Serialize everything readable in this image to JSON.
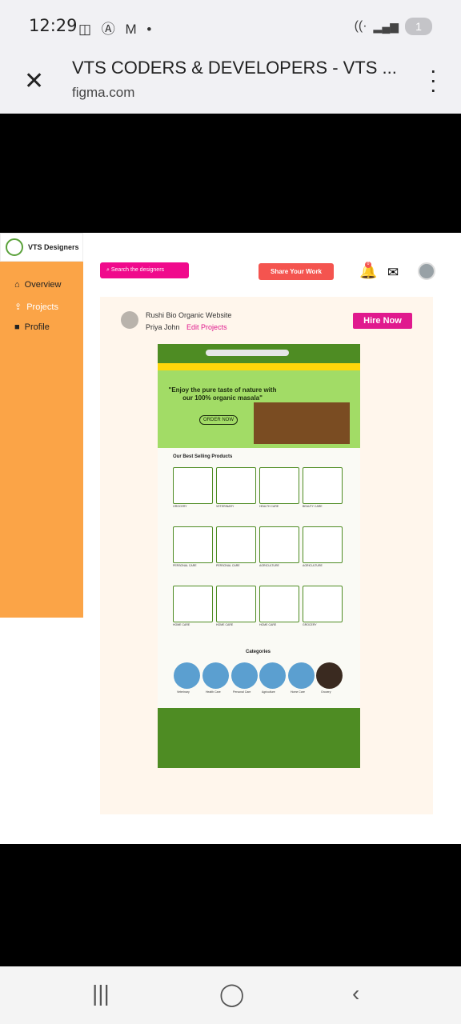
{
  "status_bar": {
    "time": "12:29",
    "icons": "◫ Ⓐ M •",
    "battery": "1"
  },
  "browser": {
    "title": "VTS CODERS & DEVELOPERS - VTS ...",
    "url": "figma.com"
  },
  "sidebar": {
    "logo_text": "VTS Designers",
    "items": [
      {
        "label": "Overview",
        "icon": "home-icon"
      },
      {
        "label": "Projects",
        "icon": "upload-icon"
      },
      {
        "label": "Profile",
        "icon": "folder-icon"
      }
    ]
  },
  "header": {
    "search_label": "Search the designers",
    "share_label": "Share Your Work",
    "notification_count": "0"
  },
  "project": {
    "title": "Rushi Bio Organic Website",
    "author": "Priya John",
    "edit_label": "Edit Projects",
    "hire_label": "Hire Now"
  },
  "design": {
    "hero_text": "\"Enjoy the pure taste of nature with our 100% organic masala\"",
    "order_label": "ORDER NOW",
    "best_selling": "Our Best Selling Products",
    "categories_title": "Categories",
    "products": [
      "GROCERY",
      "VETERINARY",
      "HEALTH CARE",
      "BEAUTY CARE",
      "PERSONAL CARE",
      "PERSONAL CARE",
      "AGRICULTURE",
      "AGRICULTURE",
      "HOME CARE",
      "HOME CARE",
      "HOME CARE",
      "GROCERY"
    ],
    "categories": [
      "Veterinary",
      "Health Care",
      "Personal Care",
      "Agriculture",
      "Home Care",
      "Grocery"
    ]
  }
}
